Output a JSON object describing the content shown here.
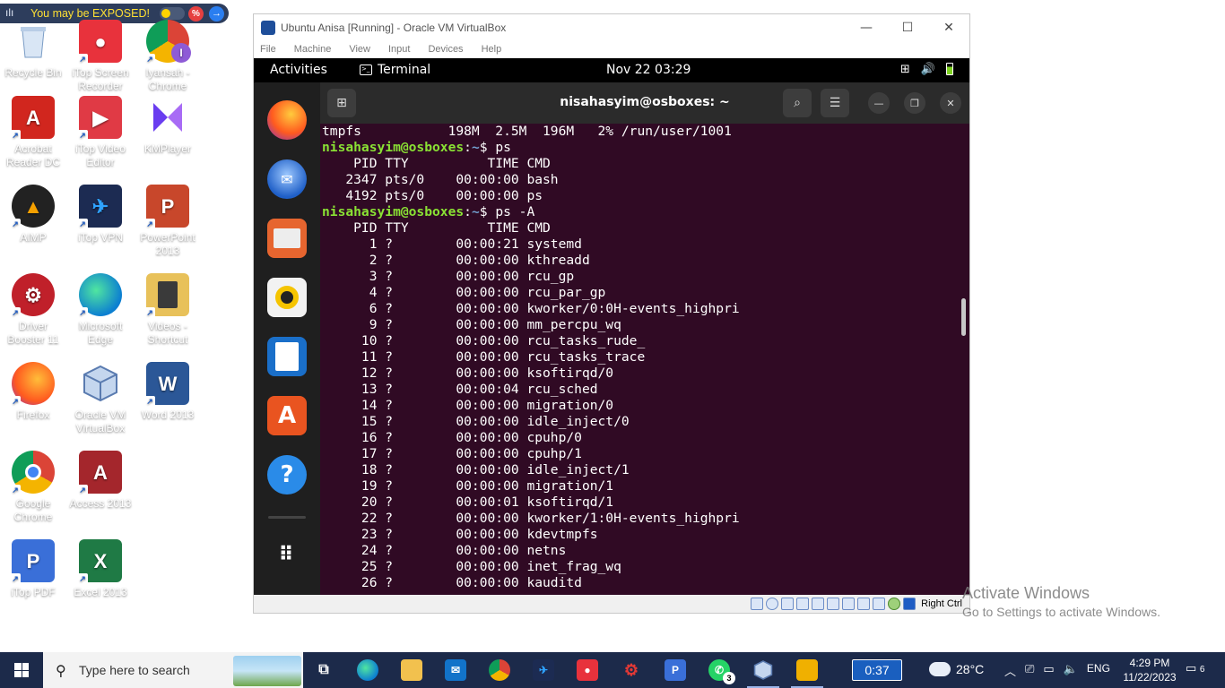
{
  "vpn_banner": {
    "text": "You may be EXPOSED!",
    "pct": "%"
  },
  "desktop_icons": [
    {
      "label": "Recycle Bin"
    },
    {
      "label": "iTop Screen Recorder"
    },
    {
      "label": "Iyansah - Chrome"
    },
    {
      "label": "Acrobat Reader DC"
    },
    {
      "label": "iTop Video Editor"
    },
    {
      "label": "KMPlayer"
    },
    {
      "label": "AIMP"
    },
    {
      "label": "iTop VPN"
    },
    {
      "label": "PowerPoint 2013"
    },
    {
      "label": "Driver Booster 11"
    },
    {
      "label": "Microsoft Edge"
    },
    {
      "label": "Videos - Shortcut"
    },
    {
      "label": "Firefox"
    },
    {
      "label": "Oracle VM VirtualBox"
    },
    {
      "label": "Word 2013"
    },
    {
      "label": "Google Chrome"
    },
    {
      "label": "Access 2013"
    },
    {
      "label": "iTop PDF"
    },
    {
      "label": "Excel 2013"
    }
  ],
  "vbox": {
    "title": "Ubuntu Anisa [Running] - Oracle VM VirtualBox",
    "menu": [
      "File",
      "Machine",
      "View",
      "Input",
      "Devices",
      "Help"
    ],
    "status_right_ctrl": "Right Ctrl"
  },
  "gnome": {
    "activities": "Activities",
    "app_name": "Terminal",
    "clock": "Nov 22  03:29"
  },
  "terminal": {
    "title": "nisahasyim@osboxes: ~",
    "user_host": "nisahasyim@osboxes",
    "path": "~",
    "lines": [
      {
        "type": "text",
        "text": "tmpfs           198M  2.5M  196M   2% /run/user/1001"
      },
      {
        "type": "prompt",
        "cmd": "$ ps"
      },
      {
        "type": "text",
        "text": "    PID TTY          TIME CMD"
      },
      {
        "type": "text",
        "text": "   2347 pts/0    00:00:00 bash"
      },
      {
        "type": "text",
        "text": "   4192 pts/0    00:00:00 ps"
      },
      {
        "type": "prompt",
        "cmd": "$ ps -A"
      },
      {
        "type": "text",
        "text": "    PID TTY          TIME CMD"
      },
      {
        "type": "text",
        "text": "      1 ?        00:00:21 systemd"
      },
      {
        "type": "text",
        "text": "      2 ?        00:00:00 kthreadd"
      },
      {
        "type": "text",
        "text": "      3 ?        00:00:00 rcu_gp"
      },
      {
        "type": "text",
        "text": "      4 ?        00:00:00 rcu_par_gp"
      },
      {
        "type": "text",
        "text": "      6 ?        00:00:00 kworker/0:0H-events_highpri"
      },
      {
        "type": "text",
        "text": "      9 ?        00:00:00 mm_percpu_wq"
      },
      {
        "type": "text",
        "text": "     10 ?        00:00:00 rcu_tasks_rude_"
      },
      {
        "type": "text",
        "text": "     11 ?        00:00:00 rcu_tasks_trace"
      },
      {
        "type": "text",
        "text": "     12 ?        00:00:00 ksoftirqd/0"
      },
      {
        "type": "text",
        "text": "     13 ?        00:00:04 rcu_sched"
      },
      {
        "type": "text",
        "text": "     14 ?        00:00:00 migration/0"
      },
      {
        "type": "text",
        "text": "     15 ?        00:00:00 idle_inject/0"
      },
      {
        "type": "text",
        "text": "     16 ?        00:00:00 cpuhp/0"
      },
      {
        "type": "text",
        "text": "     17 ?        00:00:00 cpuhp/1"
      },
      {
        "type": "text",
        "text": "     18 ?        00:00:00 idle_inject/1"
      },
      {
        "type": "text",
        "text": "     19 ?        00:00:00 migration/1"
      },
      {
        "type": "text",
        "text": "     20 ?        00:00:01 ksoftirqd/1"
      },
      {
        "type": "text",
        "text": "     22 ?        00:00:00 kworker/1:0H-events_highpri"
      },
      {
        "type": "text",
        "text": "     23 ?        00:00:00 kdevtmpfs"
      },
      {
        "type": "text",
        "text": "     24 ?        00:00:00 netns"
      },
      {
        "type": "text",
        "text": "     25 ?        00:00:00 inet_frag_wq"
      },
      {
        "type": "text",
        "text": "     26 ?        00:00:00 kauditd"
      }
    ]
  },
  "activate": {
    "line1": "Activate Windows",
    "line2": "Go to Settings to activate Windows."
  },
  "taskbar": {
    "search_placeholder": "Type here to search",
    "whatsapp_badge": "3",
    "timer": "0:37",
    "temperature": "28°C",
    "language": "ENG",
    "time": "4:29 PM",
    "date": "11/22/2023",
    "notifications": "6"
  }
}
